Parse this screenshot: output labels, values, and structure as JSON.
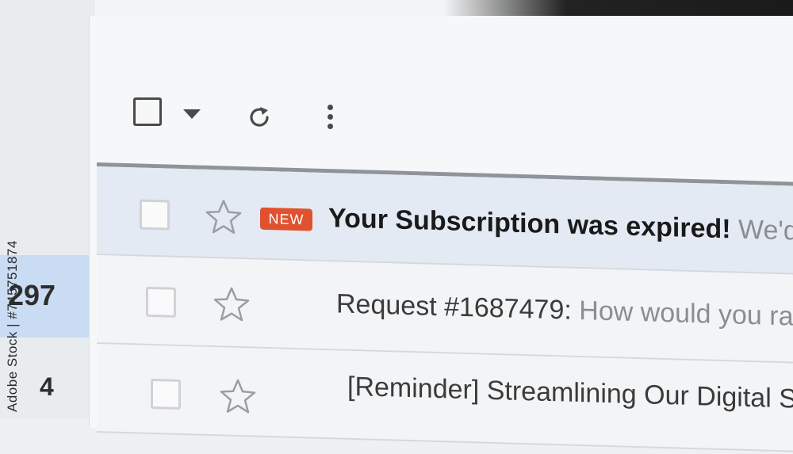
{
  "sidebar": {
    "counts": [
      "297",
      "4"
    ]
  },
  "toolbar": {
    "select_all": "select-all-checkbox",
    "select_menu": "chevron-down-icon",
    "refresh": "refresh-icon",
    "more": "more-vertical-icon"
  },
  "emails": [
    {
      "badge": "NEW",
      "subject": "Your Subscription was expired!",
      "preview": " We'd like",
      "unread": true
    },
    {
      "subject": "Request #1687479:",
      "preview": " How would you rate the",
      "unread": false
    },
    {
      "subject": "[Reminder] Streamlining Our Digital Space",
      "preview": "",
      "unread": false
    }
  ],
  "watermark": "Adobe Stock | #745751874",
  "colors": {
    "badge": "#e0522f",
    "selected_folder": "#c9dcf3",
    "unread_row": "#e4eaf4"
  }
}
